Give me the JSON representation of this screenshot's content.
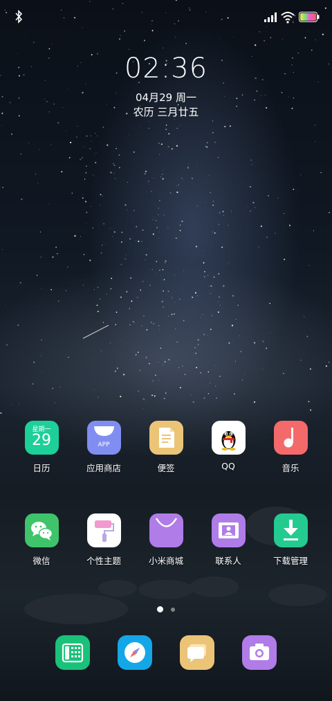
{
  "status_bar": {
    "bluetooth": "bluetooth-icon",
    "signal": "signal-icon",
    "wifi": "wifi-icon",
    "battery": "battery-icon"
  },
  "lockclock": {
    "time": "02:36",
    "date": "04月29 周一",
    "lunar": "农历 三月廿五"
  },
  "calendar_icon": {
    "weekday": "星期一",
    "day": "29"
  },
  "app_store_icon_text": "APP",
  "apps_row1": [
    {
      "label": "日历",
      "color": "#1dcf98"
    },
    {
      "label": "应用商店",
      "color": "#7f8ef0"
    },
    {
      "label": "便签",
      "color": "#ecc477"
    },
    {
      "label": "QQ",
      "color": "#ffffff"
    },
    {
      "label": "音乐",
      "color": "#f46a6a"
    }
  ],
  "apps_row2": [
    {
      "label": "微信",
      "color": "#3fc36b"
    },
    {
      "label": "个性主题",
      "color": "#ffffff"
    },
    {
      "label": "小米商城",
      "color": "#b07ce8"
    },
    {
      "label": "联系人",
      "color": "#b07ce8"
    },
    {
      "label": "下载管理",
      "color": "#23cb91"
    }
  ],
  "dock": [
    {
      "name": "phone-icon",
      "color": "#1ac279"
    },
    {
      "name": "browser-icon",
      "color": "#13a7e8"
    },
    {
      "name": "messages-icon",
      "color": "#ecc477"
    },
    {
      "name": "camera-icon",
      "color": "#b07ce8"
    }
  ],
  "page_indicator": {
    "pages": 2,
    "current": 1
  }
}
